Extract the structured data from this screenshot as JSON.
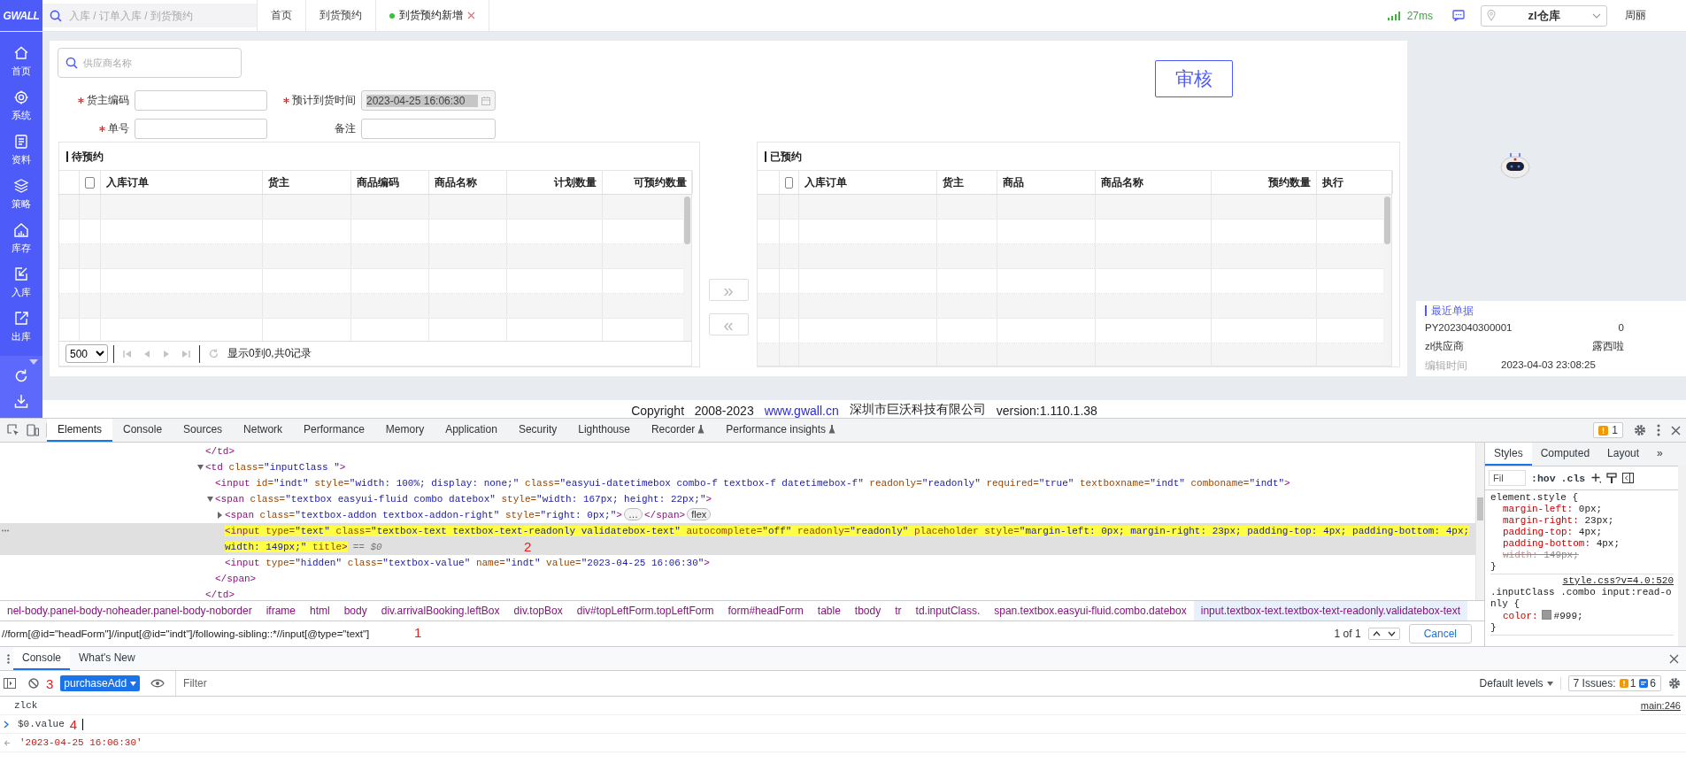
{
  "header": {
    "logo": "GWALL",
    "search": {
      "placeholder": "入库 / 订单入库 / 到货预约"
    },
    "tabs": [
      {
        "label": "首页",
        "selected": false,
        "closable": false
      },
      {
        "label": "到货预约",
        "selected": false,
        "closable": false
      },
      {
        "label": "到货预约新增",
        "selected": true,
        "closable": true
      }
    ],
    "latency": "27ms",
    "warehouse": "zl仓库",
    "user": "周丽"
  },
  "sidebar": {
    "items": [
      {
        "label": "首页"
      },
      {
        "label": "系统"
      },
      {
        "label": "资料"
      },
      {
        "label": "策略"
      },
      {
        "label": "库存"
      },
      {
        "label": "入库"
      },
      {
        "label": "出库"
      }
    ]
  },
  "form": {
    "supplier_search": {
      "placeholder": "供应商名称"
    },
    "review_button": "审核",
    "fields": [
      {
        "label": "货主编码",
        "required": true,
        "readonly": false
      },
      {
        "label": "预计到货时间",
        "required": true,
        "readonly": true,
        "value": "2023-04-25 16:06:30"
      },
      {
        "label": "单号",
        "required": true,
        "readonly": false
      },
      {
        "label": "备注",
        "required": false,
        "readonly": false
      }
    ]
  },
  "pending_table": {
    "title": "待预约",
    "header_checked": false,
    "columns": [
      "入库订单",
      "货主",
      "商品编码",
      "商品名称",
      "计划数量",
      "可预约数量"
    ],
    "pager": {
      "page_size": "500",
      "status": "显示0到0,共0记录"
    }
  },
  "transfer_buttons": [
    "»",
    "«"
  ],
  "booked_table": {
    "title": "已预约",
    "header_checked": false,
    "columns": [
      "入库订单",
      "货主",
      "商品",
      "商品名称",
      "预约数量",
      "执行"
    ]
  },
  "recent": {
    "title": "最近单据",
    "rows": [
      {
        "kind": "pair",
        "label": "PY2023040300001",
        "value": "0"
      },
      {
        "kind": "pair",
        "label": "zl供应商",
        "value": "露西啦"
      },
      {
        "kind": "field",
        "label": "编辑时间",
        "value": "2023-04-03 23:08:25"
      }
    ]
  },
  "footer": {
    "copyright": "Copyright   2008-2023",
    "link": "www.gwall.cn",
    "company": "深圳市巨沃科技有限公司",
    "version": "version:1.110.1.38"
  },
  "devtools": {
    "tabs": [
      {
        "label": "Elements",
        "selected": true,
        "experimental": false
      },
      {
        "label": "Console",
        "selected": false,
        "experimental": false
      },
      {
        "label": "Sources",
        "selected": false,
        "experimental": false
      },
      {
        "label": "Network",
        "selected": false,
        "experimental": false
      },
      {
        "label": "Performance",
        "selected": false,
        "experimental": false
      },
      {
        "label": "Memory",
        "selected": false,
        "experimental": false
      },
      {
        "label": "Application",
        "selected": false,
        "experimental": false
      },
      {
        "label": "Security",
        "selected": false,
        "experimental": false
      },
      {
        "label": "Lighthouse",
        "selected": false,
        "experimental": false
      },
      {
        "label": "Recorder",
        "selected": false,
        "experimental": true
      },
      {
        "label": "Performance insights",
        "selected": false,
        "experimental": true
      }
    ],
    "issues_count": "1",
    "dom_tree": [
      {
        "text": "</td>"
      },
      {
        "text": "<td class=\"inputClass \">",
        "expanded": true,
        "closing": "</td>",
        "children": [
          {
            "text": "<input id=\"indt\" style=\"width: 100%; display: none;\" class=\"easyui-datetimebox combo-f textbox-f datetimebox-f\" readonly=\"readonly\" required=\"true\" textboxname=\"indt\" comboname=\"indt\">"
          },
          {
            "text": "<span class=\"textbox easyui-fluid combo datebox\" style=\"width: 167px; height: 22px;\">",
            "expanded": true,
            "closing": "</span>",
            "children": [
              {
                "text": "<span class=\"textbox-addon textbox-addon-right\" style=\"right: 0px;\">",
                "expanded": false,
                "collapsed_marker": "…",
                "closing": "</span>",
                "badge": "flex"
              },
              {
                "text": "<input type=\"text\" class=\"textbox-text textbox-text-readonly validatebox-text\" autocomplete=\"off\" readonly=\"readonly\" placeholder style=\"margin-left: 0px; margin-right: 23px; padding-top: 4px; padding-bottom: 4px; width: 149px;\" title>",
                "selected": true,
                "note": "== $0",
                "annotation": "2"
              },
              {
                "text": "<input type=\"hidden\" class=\"textbox-value\" name=\"indt\" value=\"2023-04-25 16:06:30\">"
              }
            ]
          }
        ]
      }
    ],
    "breadcrumbs": [
      {
        "label": "nel-body.panel-body-noheader.panel-body-noborder",
        "selected": false
      },
      {
        "label": "iframe",
        "selected": false
      },
      {
        "label": "html",
        "selected": false
      },
      {
        "label": "body",
        "selected": false
      },
      {
        "label": "div.arrivalBooking.leftBox",
        "selected": false
      },
      {
        "label": "div.topBox",
        "selected": false
      },
      {
        "label": "div#topLeftForm.topLeftForm",
        "selected": false
      },
      {
        "label": "form#headForm",
        "selected": false
      },
      {
        "label": "table",
        "selected": false
      },
      {
        "label": "tbody",
        "selected": false
      },
      {
        "label": "tr",
        "selected": false
      },
      {
        "label": "td.inputClass.",
        "selected": false
      },
      {
        "label": "span.textbox.easyui-fluid.combo.datebox",
        "selected": false
      },
      {
        "label": "input.textbox-text.textbox-text-readonly.validatebox-text",
        "selected": true
      }
    ],
    "search": {
      "query": "//form[@id=\"headForm\"]//input[@id=\"indt\"]/following-sibling::*//input[@type=\"text\"]",
      "annotation": "1",
      "match_count": "1 of 1",
      "cancel": "Cancel"
    },
    "styles": {
      "tabs": [
        {
          "label": "Styles",
          "selected": true
        },
        {
          "label": "Computed",
          "selected": false
        },
        {
          "label": "Layout",
          "selected": false
        }
      ],
      "more": "»",
      "filter_placeholder": "Fil",
      "hov": ":hov",
      "cls": ".cls",
      "rules": [
        {
          "selector": "element.style {",
          "close": "}",
          "properties": [
            {
              "text": "margin-left: 0px;",
              "overridden": false
            },
            {
              "text": "margin-right: 23px;",
              "overridden": false
            },
            {
              "text": "padding-top: 4px;",
              "overridden": false
            },
            {
              "text": "padding-bottom: 4px;",
              "overridden": false
            },
            {
              "text": "width: 149px;",
              "overridden": true
            }
          ]
        },
        {
          "selector": ".inputClass .combo input:read-only {",
          "source": "style.css?v=4.0:520",
          "close": "}",
          "properties": [
            {
              "text": "color: #999;",
              "overridden": false,
              "kind": "color"
            }
          ]
        }
      ]
    },
    "console": {
      "tabs": [
        {
          "label": "Console",
          "selected": true
        },
        {
          "label": "What's New",
          "selected": false
        }
      ],
      "context": "purchaseAdd",
      "context_annotation": "3",
      "filter_placeholder": "Filter",
      "levels": "Default levels",
      "issues_label": "7 Issues:",
      "warnings": "1",
      "infos": "6",
      "messages": [
        {
          "kind": "log",
          "text": "zlck",
          "source": "main:246"
        },
        {
          "kind": "input",
          "text": "$0.value",
          "annotation": "4"
        },
        {
          "kind": "result",
          "text": "'2023-04-25 16:06:30'"
        }
      ]
    }
  }
}
